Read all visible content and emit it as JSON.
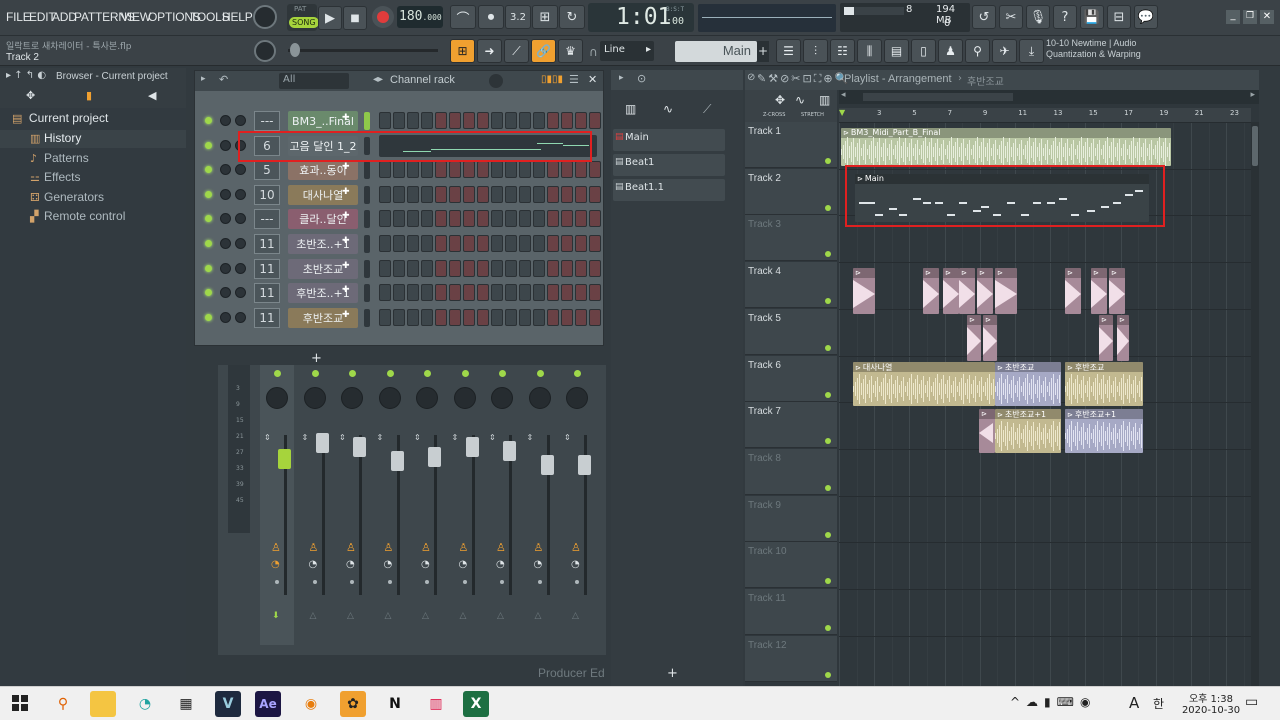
{
  "menu": [
    "FILE",
    "EDIT",
    "ADD",
    "PATTERNS",
    "VIEW",
    "OPTIONS",
    "TOOLS",
    "HELP"
  ],
  "transport": {
    "pat_label": "PAT",
    "song_label": "SONG",
    "tempo": "180",
    "tempo_frac": ".000",
    "time": "1:01",
    "time_sub": ":00",
    "bst": "B:S:T",
    "cpu": "8",
    "mem": "194 MB",
    "poly": "0"
  },
  "hint": {
    "filename": "일락트로 새차레이터 - 특사본.flp",
    "track": "Track 2"
  },
  "toolbar2": {
    "snap": "Line",
    "pattern": "Main",
    "news_line1": "10-10  Newtime | Audio",
    "news_line2": "Quantization & Warping"
  },
  "browser": {
    "title": "Browser - Current project",
    "root": "Current project",
    "items": [
      {
        "label": "History",
        "selected": true
      },
      {
        "label": "Patterns",
        "selected": false
      },
      {
        "label": "Effects",
        "selected": false
      },
      {
        "label": "Generators",
        "selected": false
      },
      {
        "label": "Remote control",
        "selected": false
      }
    ]
  },
  "rack": {
    "filter": "All",
    "title": "Channel rack",
    "channels": [
      {
        "num": "---",
        "name": "BM3_..Final",
        "color": "#6a8a6c",
        "mode": "steps"
      },
      {
        "num": "6",
        "name": "고음 달인 1_2",
        "color": "#5d676c",
        "mode": "roll"
      },
      {
        "num": "5",
        "name": "효과..동이",
        "color": "#8b7266",
        "mode": "steps"
      },
      {
        "num": "10",
        "name": "대사나열",
        "color": "#8a7a5a",
        "mode": "steps"
      },
      {
        "num": "---",
        "name": "클라..달인",
        "color": "#8a5e6f",
        "mode": "steps"
      },
      {
        "num": "11",
        "name": "초반조..+1",
        "color": "#6d6a78",
        "mode": "steps"
      },
      {
        "num": "11",
        "name": "초반조교",
        "color": "#6d6a78",
        "mode": "steps"
      },
      {
        "num": "11",
        "name": "후반조..+1",
        "color": "#6d6a78",
        "mode": "steps"
      },
      {
        "num": "11",
        "name": "후반조교",
        "color": "#8a7a5a",
        "mode": "steps"
      }
    ],
    "add": "+"
  },
  "mixer": {
    "meter_labels": [
      "3",
      "9",
      "15",
      "21",
      "27",
      "33",
      "39",
      "45"
    ],
    "watermark": "Producer Ed"
  },
  "patterns": [
    {
      "label": "Main",
      "active": true
    },
    {
      "label": "Beat1",
      "active": false
    },
    {
      "label": "Beat1.1",
      "active": false
    }
  ],
  "playlist": {
    "title": "Playlist - Arrangement",
    "breadcrumb": "후반조교",
    "zcross": "Z-CROSS",
    "stretch": "STRETCH",
    "ruler": [
      "3",
      "5",
      "7",
      "9",
      "11",
      "13",
      "15",
      "17",
      "19",
      "21",
      "23"
    ],
    "tracks": [
      "Track 1",
      "Track 2",
      "Track 3",
      "Track 4",
      "Track 5",
      "Track 6",
      "Track 7",
      "Track 8",
      "Track 9",
      "Track 10",
      "Track 11",
      "Track 12"
    ],
    "clips": {
      "t1": "BM3_Midi_Part_B_Final",
      "t2": "Main",
      "t6a": "대사나열",
      "t6b": "초반조교",
      "t6c": "후반조교",
      "t7a": "초반조교+1",
      "t7b": "후반조교+1"
    }
  },
  "taskbar": {
    "time": "오후 1:38",
    "date": "2020-10-30",
    "ime": "A",
    "lang": "한"
  },
  "colors": {
    "accent_orange": "#f0a030",
    "highlight_red": "#e02020",
    "led_green": "#9fd84a",
    "audio_clip": "#b9c7a4"
  }
}
